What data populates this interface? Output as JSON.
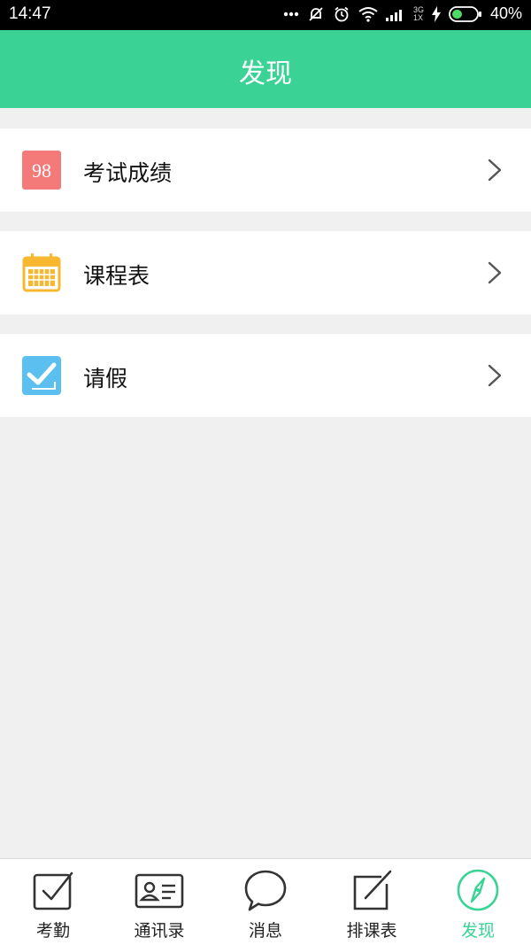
{
  "status_bar": {
    "time": "14:47",
    "network_top": "3G",
    "network_bottom": "1X",
    "battery": "40%"
  },
  "header": {
    "title": "发现"
  },
  "menu": [
    {
      "label": "考试成绩",
      "icon": "exam-score-icon",
      "icon_text": "98",
      "icon_color": "#f47a7a"
    },
    {
      "label": "课程表",
      "icon": "calendar-icon",
      "icon_color": "#f7b731"
    },
    {
      "label": "请假",
      "icon": "leave-check-icon",
      "icon_color": "#5bc0f0"
    }
  ],
  "bottom_nav": {
    "tabs": [
      {
        "label": "考勤",
        "icon": "checkbox-icon",
        "active": false
      },
      {
        "label": "通讯录",
        "icon": "contact-card-icon",
        "active": false
      },
      {
        "label": "消息",
        "icon": "chat-bubble-icon",
        "active": false
      },
      {
        "label": "排课表",
        "icon": "edit-icon",
        "active": false
      },
      {
        "label": "发现",
        "icon": "compass-icon",
        "active": true
      }
    ],
    "active_color": "#3ad395"
  }
}
